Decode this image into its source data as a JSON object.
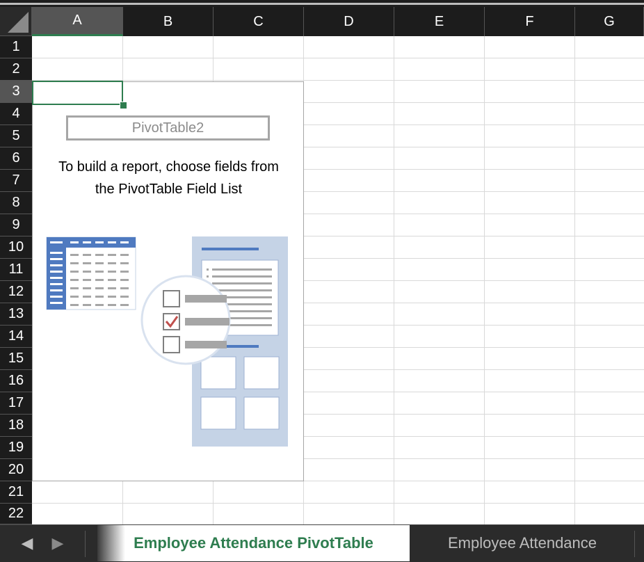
{
  "columns": [
    "A",
    "B",
    "C",
    "D",
    "E",
    "F",
    "G"
  ],
  "rows": [
    "1",
    "2",
    "3",
    "4",
    "5",
    "6",
    "7",
    "8",
    "9",
    "10",
    "11",
    "12",
    "13",
    "14",
    "15",
    "16",
    "17",
    "18",
    "19",
    "20",
    "21",
    "22"
  ],
  "active_column": "A",
  "active_row": "3",
  "pivot": {
    "name": "PivotTable2",
    "instructions_line1": "To build a report, choose fields from",
    "instructions_line2": "the PivotTable Field List"
  },
  "sheet_tabs": [
    {
      "label": "Employee Attendance PivotTable",
      "active": true
    },
    {
      "label": "Employee Attendance",
      "active": false
    }
  ],
  "nav": {
    "prev_icon": "triangle-left-icon",
    "next_icon": "triangle-right-icon"
  },
  "colors": {
    "accent": "#2e7d4f",
    "header_bg": "#1c1c1c",
    "gridline": "#d9d9d9",
    "pivot_blue": "#4f7ac0",
    "pivot_light": "#c5d3e6"
  }
}
